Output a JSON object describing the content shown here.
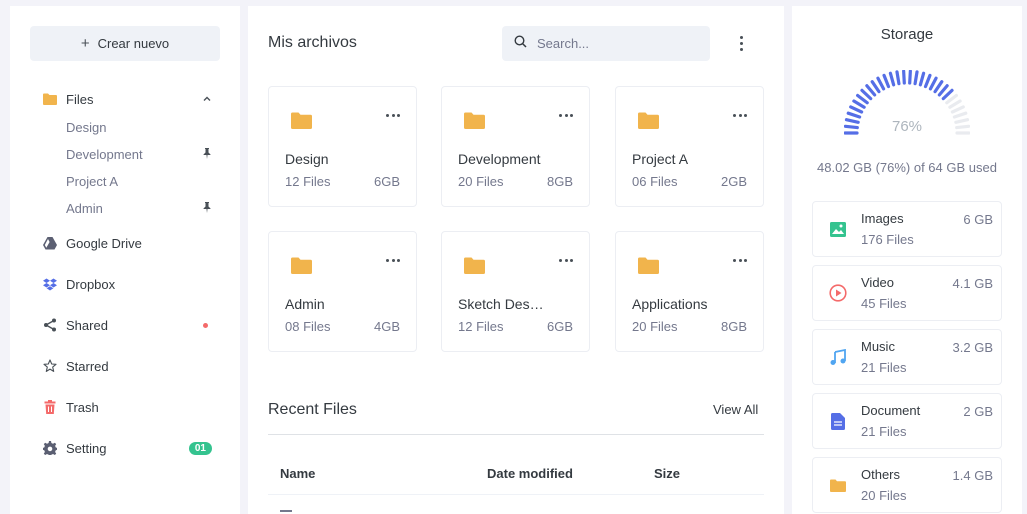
{
  "sidebar": {
    "create_label": "Crear nuevo",
    "files_label": "Files",
    "subfolders": [
      {
        "label": "Design",
        "pinned": false
      },
      {
        "label": "Development",
        "pinned": true
      },
      {
        "label": "Project A",
        "pinned": false
      },
      {
        "label": "Admin",
        "pinned": true
      }
    ],
    "items": [
      {
        "label": "Google Drive",
        "icon": "google-drive-icon"
      },
      {
        "label": "Dropbox",
        "icon": "dropbox-icon"
      },
      {
        "label": "Shared",
        "icon": "share-icon"
      },
      {
        "label": "Starred",
        "icon": "star-icon"
      },
      {
        "label": "Trash",
        "icon": "trash-icon"
      },
      {
        "label": "Setting",
        "icon": "gear-icon",
        "badge": "01"
      }
    ]
  },
  "main": {
    "title": "Mis archivos",
    "search_placeholder": "Search...",
    "folders": [
      {
        "name": "Design",
        "files": "12 Files",
        "size": "6GB"
      },
      {
        "name": "Development",
        "files": "20 Files",
        "size": "8GB"
      },
      {
        "name": "Project A",
        "files": "06 Files",
        "size": "2GB"
      },
      {
        "name": "Admin",
        "files": "08 Files",
        "size": "4GB"
      },
      {
        "name": "Sketch Design",
        "files": "12 Files",
        "size": "6GB"
      },
      {
        "name": "Applications",
        "files": "20 Files",
        "size": "8GB"
      }
    ],
    "recent_title": "Recent Files",
    "view_all": "View All",
    "columns": [
      "Name",
      "Date modified",
      "Size"
    ]
  },
  "storage": {
    "title": "Storage",
    "percent": "76%",
    "percent_value": 76,
    "used_text": "48.02 GB (76%) of 64 GB used",
    "categories": [
      {
        "name": "Images",
        "files": "176 Files",
        "size": "6 GB",
        "icon": "image-icon",
        "color": "#34c38f"
      },
      {
        "name": "Video",
        "files": "45 Files",
        "size": "4.1 GB",
        "icon": "play-circle-icon",
        "color": "#f46a6a"
      },
      {
        "name": "Music",
        "files": "21 Files",
        "size": "3.2 GB",
        "icon": "music-icon",
        "color": "#50a5f1"
      },
      {
        "name": "Document",
        "files": "21 Files",
        "size": "2 GB",
        "icon": "document-icon",
        "color": "#556ee6"
      },
      {
        "name": "Others",
        "files": "20 Files",
        "size": "1.4 GB",
        "icon": "folder-icon",
        "color": "#f1b44c"
      }
    ]
  },
  "colors": {
    "accent": "#556ee6",
    "folder": "#f1b44c",
    "background": "#f3f3f9"
  }
}
